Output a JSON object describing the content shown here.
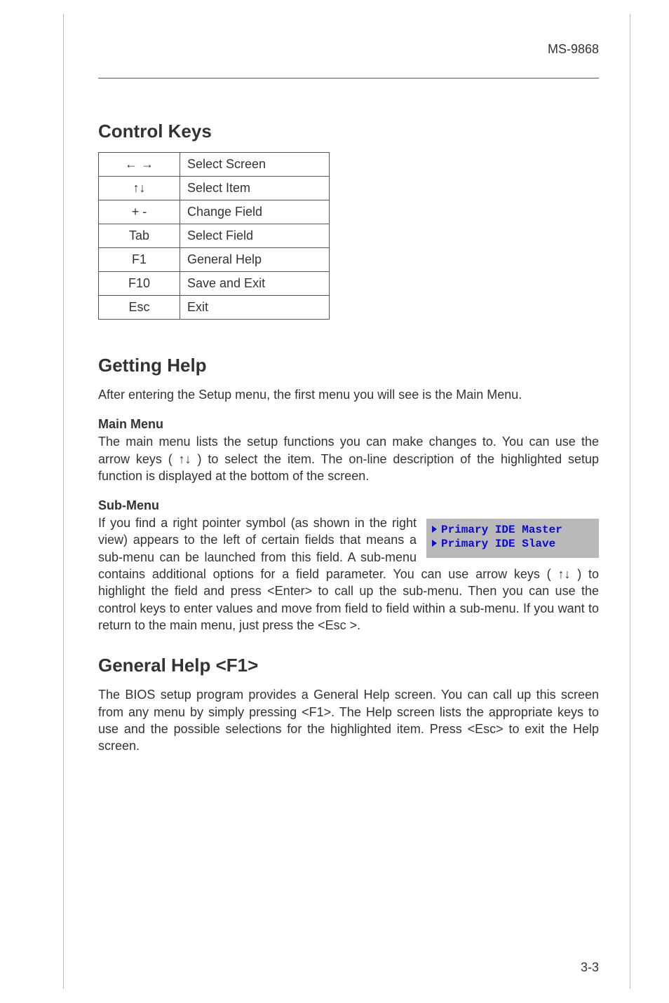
{
  "header": {
    "model": "MS-9868"
  },
  "footer": {
    "page": "3-3"
  },
  "control_keys": {
    "title": "Control Keys",
    "rows": [
      {
        "key": "← →",
        "desc": "Select Screen"
      },
      {
        "key": "↑↓",
        "desc": "Select Item"
      },
      {
        "key": "+ -",
        "desc": "Change Field"
      },
      {
        "key": "Tab",
        "desc": "Select Field"
      },
      {
        "key": "F1",
        "desc": "General Help"
      },
      {
        "key": "F10",
        "desc": "Save and Exit"
      },
      {
        "key": "Esc",
        "desc": "Exit"
      }
    ]
  },
  "getting_help": {
    "title": "Getting Help",
    "intro": "After entering the Setup menu, the first menu you will see is the Main Menu.",
    "main_menu": {
      "heading": "Main Menu",
      "text": "The main menu lists the setup functions you can make changes to. You can use the arrow keys ( ↑↓ ) to select the item. The on-line description of the highlighted setup function is displayed at the bottom of the screen."
    },
    "sub_menu": {
      "heading": "Sub-Menu",
      "text": "If you find a right pointer symbol (as shown in the right  view) appears to the left of certain fields that means a sub-menu can be launched from this field. A sub-menu contains additional options for a field parameter. You can use arrow keys  ( ↑↓ ) to highlight the field and press <Enter> to call up the sub-menu. Then you can use the control keys to enter values and  move from field to field within a sub-menu. If you want to return to the main menu, just press the <Esc >.",
      "example_items": {
        "line1": "Primary IDE Master",
        "line2": "Primary IDE Slave"
      }
    }
  },
  "general_help": {
    "title": "General Help <F1>",
    "text": "The BIOS setup program provides a General  Help screen. You can call up this screen from any menu by simply pressing <F1>. The Help screen lists the appropriate keys to use and the possible selections for the highlighted item. Press <Esc> to exit the Help screen."
  }
}
